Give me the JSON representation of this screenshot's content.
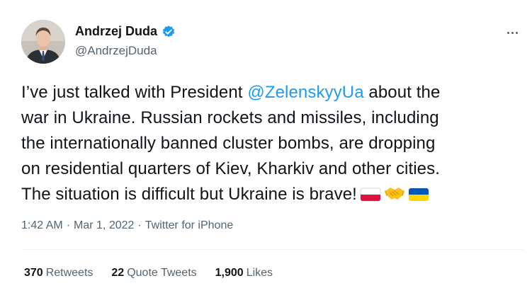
{
  "author": {
    "display_name": "Andrzej Duda",
    "handle": "@AndrzejDuda",
    "verified": true,
    "avatar_icon": "profile-photo"
  },
  "tweet": {
    "lines": [
      {
        "before": "I’ve just talked with President ",
        "mention": "@ZelenskyyUa",
        "after": " about the"
      },
      {
        "text": "war in Ukraine. Russian rockets and missiles, including"
      },
      {
        "text": "the internationally banned cluster bombs, are dropping"
      },
      {
        "text": "on residential quarters of Kiev, Kharkiv and other cities."
      },
      {
        "text": "The situation is difficult but Ukraine is brave!"
      }
    ],
    "emojis": [
      "poland-flag-icon",
      "handshake-icon",
      "ukraine-flag-icon"
    ]
  },
  "meta": {
    "time": "1:42 AM",
    "separator": "·",
    "date": "Mar 1, 2022",
    "source": "Twitter for iPhone"
  },
  "stats": {
    "retweets_count": "370",
    "retweets_label": "Retweets",
    "quotes_count": "22",
    "quotes_label": "Quote Tweets",
    "likes_count": "1,900",
    "likes_label": "Likes"
  },
  "colors": {
    "accent": "#1d9bf0",
    "text": "#0f1419",
    "secondary": "#536471",
    "divider": "#eff3f4"
  }
}
